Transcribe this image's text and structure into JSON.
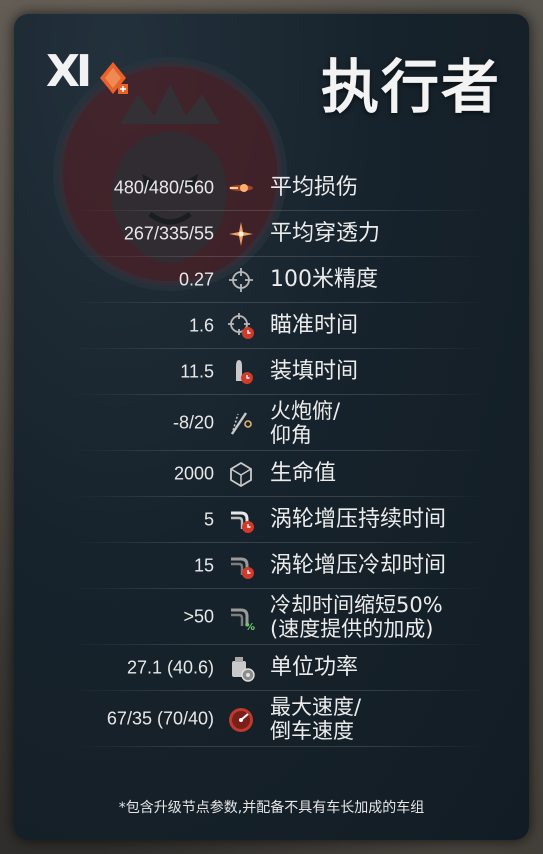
{
  "header": {
    "tier": "XI",
    "title": "执行者"
  },
  "stats": [
    {
      "value": "480/480/560",
      "label": "平均损伤",
      "icon": "shell-damage-icon"
    },
    {
      "value": "267/335/55",
      "label": "平均穿透力",
      "icon": "penetration-icon"
    },
    {
      "value": "0.27",
      "label": "100米精度",
      "icon": "crosshair-icon"
    },
    {
      "value": "1.6",
      "label": "瞄准时间",
      "icon": "aim-time-icon"
    },
    {
      "value": "11.5",
      "label": "装填时间",
      "icon": "reload-icon"
    },
    {
      "value": "-8/20",
      "label": "火炮俯/",
      "label2": "仰角",
      "icon": "gun-elevation-icon"
    },
    {
      "value": "2000",
      "label": "生命值",
      "icon": "hitpoints-icon"
    },
    {
      "value": "5",
      "label": "涡轮增压持续时间",
      "icon": "turbo-duration-icon"
    },
    {
      "value": "15",
      "label": "涡轮增压冷却时间",
      "icon": "turbo-cooldown-icon"
    },
    {
      "value": ">50",
      "label": "冷却时间缩短50%",
      "label2": "(速度提供的加成)",
      "icon": "cooldown-bonus-icon"
    },
    {
      "value": "27.1 (40.6)",
      "label": "单位功率",
      "icon": "power-ratio-icon"
    },
    {
      "value": "67/35 (70/40)",
      "label": "最大速度/",
      "label2": "倒车速度",
      "icon": "speedometer-icon"
    }
  ],
  "footnote": "*包含升级节点参数,并配备不具有车长加成的车组",
  "colors": {
    "accent_orange": "#e8622a",
    "card_bg": "#17232c",
    "emblem_red": "#7a1e22"
  }
}
